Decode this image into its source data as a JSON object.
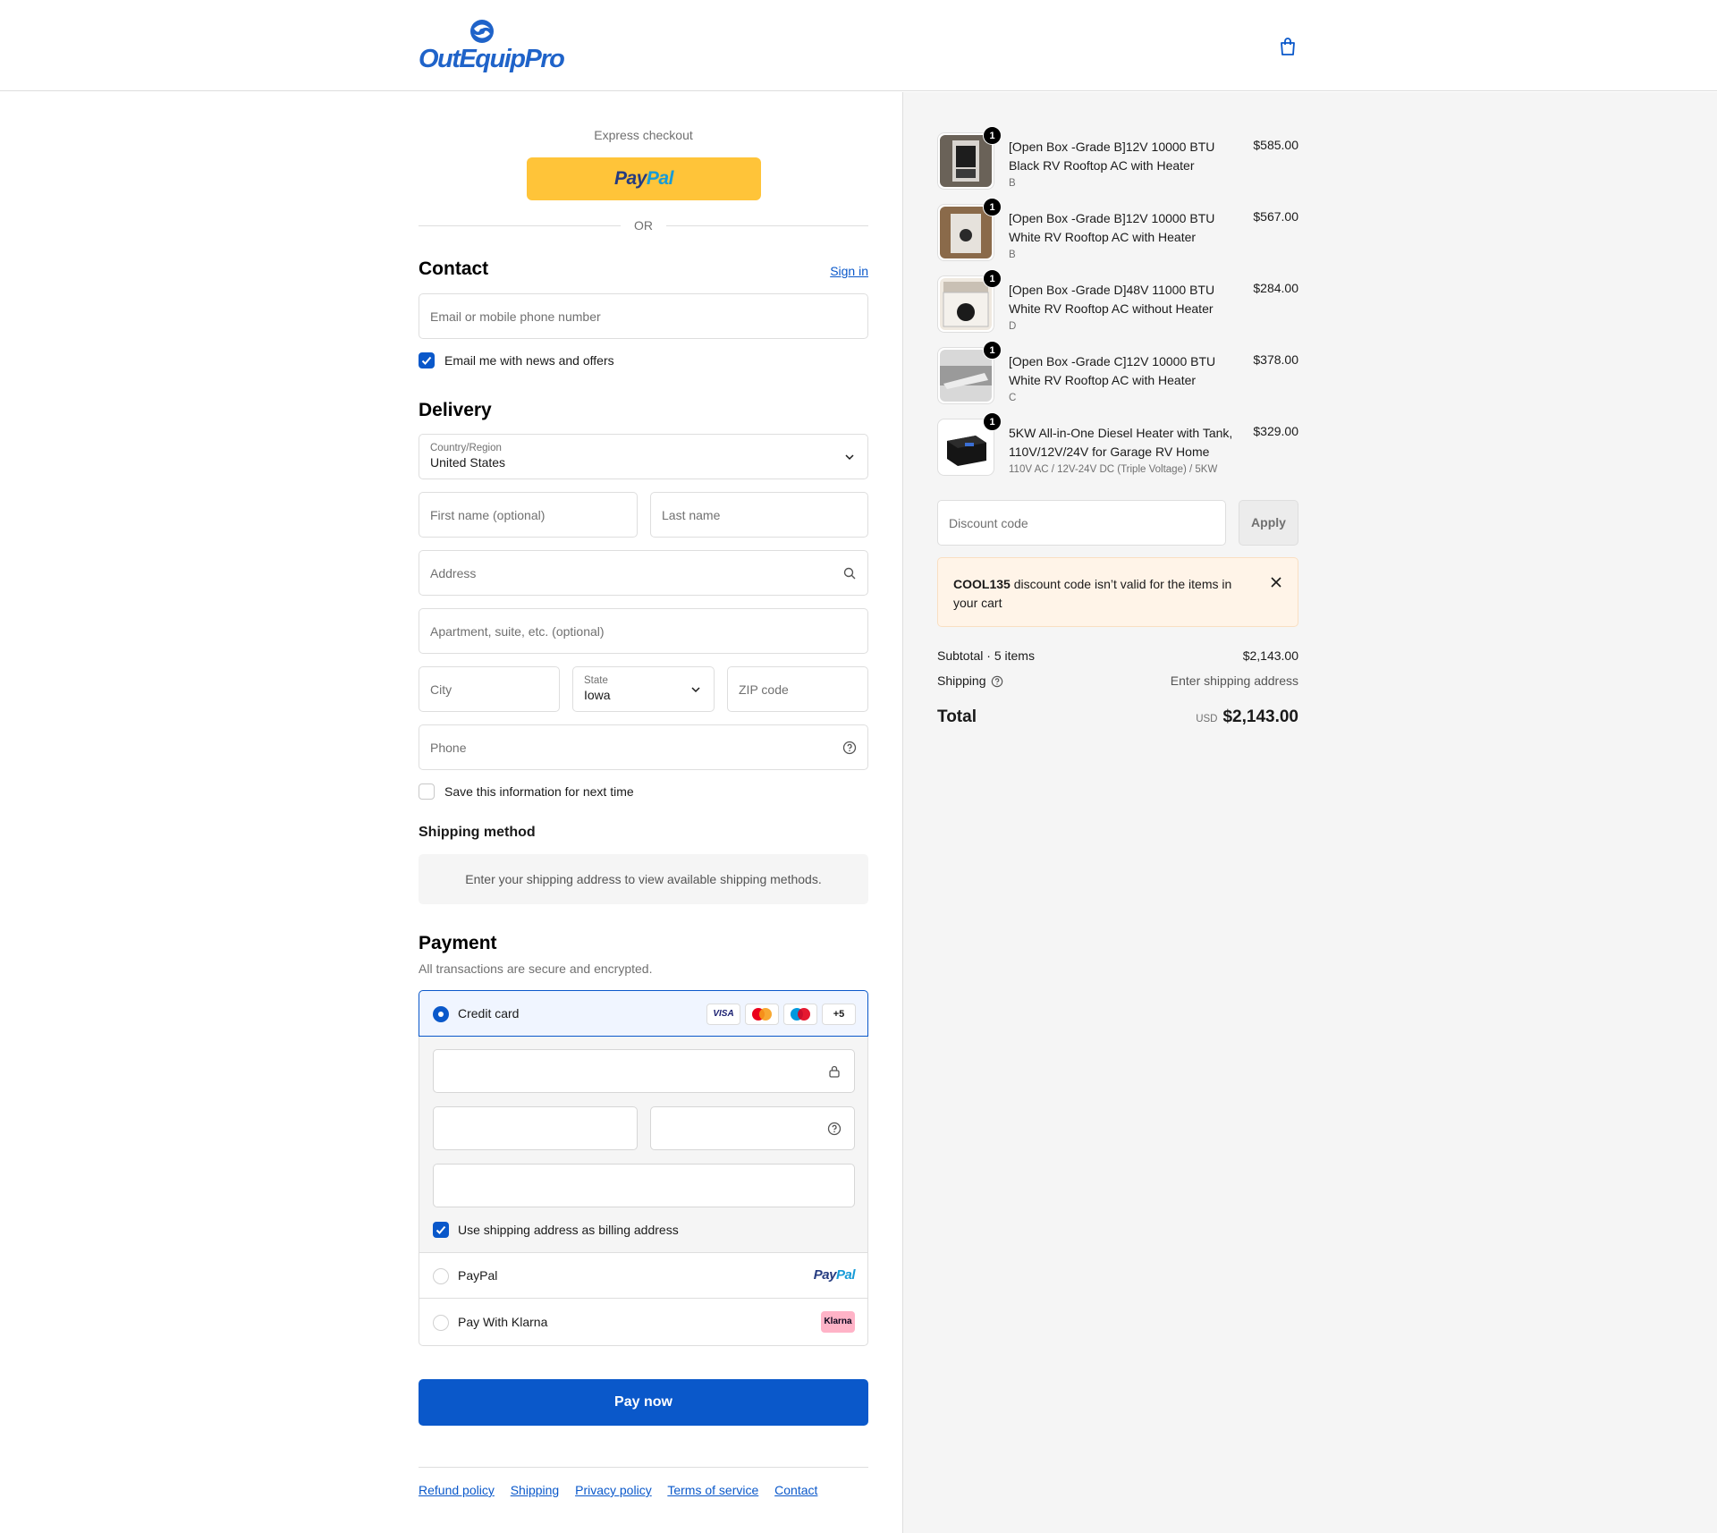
{
  "header": {
    "logo_text": "OutEquipPro"
  },
  "express": {
    "title": "Express checkout",
    "or_label": "OR",
    "paypal_a": "Pay",
    "paypal_b": "Pal"
  },
  "contact": {
    "title": "Contact",
    "sign_in": "Sign in",
    "email_placeholder": "Email or mobile phone number",
    "news_label": "Email me with news and offers",
    "news_checked": true
  },
  "delivery": {
    "title": "Delivery",
    "country_label": "Country/Region",
    "country_value": "United States",
    "first_name_placeholder": "First name (optional)",
    "last_name_placeholder": "Last name",
    "address_placeholder": "Address",
    "apartment_placeholder": "Apartment, suite, etc. (optional)",
    "city_placeholder": "City",
    "state_label": "State",
    "state_value": "Iowa",
    "zip_placeholder": "ZIP code",
    "phone_placeholder": "Phone",
    "save_label": "Save this information for next time",
    "save_checked": false
  },
  "shipping_method": {
    "title": "Shipping method",
    "message": "Enter your shipping address to view available shipping methods."
  },
  "payment": {
    "title": "Payment",
    "subtitle": "All transactions are secure and encrypted.",
    "credit_card_label": "Credit card",
    "card_icons": [
      "visa-icon",
      "mastercard-icon",
      "maestro-icon"
    ],
    "visa_text": "VISA",
    "more_cards": "+5",
    "billing_label": "Use shipping address as billing address",
    "billing_checked": true,
    "paypal_label": "PayPal",
    "klarna_label": "Pay With Klarna",
    "klarna_badge": "Klarna",
    "pay_now": "Pay now"
  },
  "footer": {
    "links": [
      "Refund policy",
      "Shipping",
      "Privacy policy",
      "Terms of service",
      "Contact"
    ]
  },
  "cart": {
    "items": [
      {
        "name": "[Open Box -Grade B]12V 10000 BTU Black RV Rooftop AC with Heater",
        "variant": "B",
        "price": "$585.00",
        "qty": "1"
      },
      {
        "name": "[Open Box -Grade B]12V 10000 BTU White RV Rooftop AC with Heater",
        "variant": "B",
        "price": "$567.00",
        "qty": "1"
      },
      {
        "name": "[Open Box -Grade D]48V 11000 BTU White RV Rooftop AC without Heater",
        "variant": "D",
        "price": "$284.00",
        "qty": "1"
      },
      {
        "name": "[Open Box -Grade C]12V 10000 BTU White RV Rooftop AC with Heater",
        "variant": "C",
        "price": "$378.00",
        "qty": "1"
      },
      {
        "name": "5KW All-in-One Diesel Heater with Tank, 110V/12V/24V for Garage RV Home",
        "variant": "110V AC / 12V-24V DC (Triple Voltage) / 5KW",
        "price": "$329.00",
        "qty": "1"
      }
    ],
    "discount_placeholder": "Discount code",
    "apply_label": "Apply",
    "error_code": "COOL135",
    "error_message": " discount code isn’t valid for the items in your cart",
    "subtotal_label": "Subtotal · 5 items",
    "subtotal_value": "$2,143.00",
    "shipping_label": "Shipping",
    "shipping_value": "Enter shipping address",
    "total_label": "Total",
    "currency": "USD",
    "total_value": "$2,143.00"
  },
  "colors": {
    "accent": "#0a58ca",
    "paypal_yellow": "#ffc439",
    "error_bg": "#fff4e8"
  }
}
